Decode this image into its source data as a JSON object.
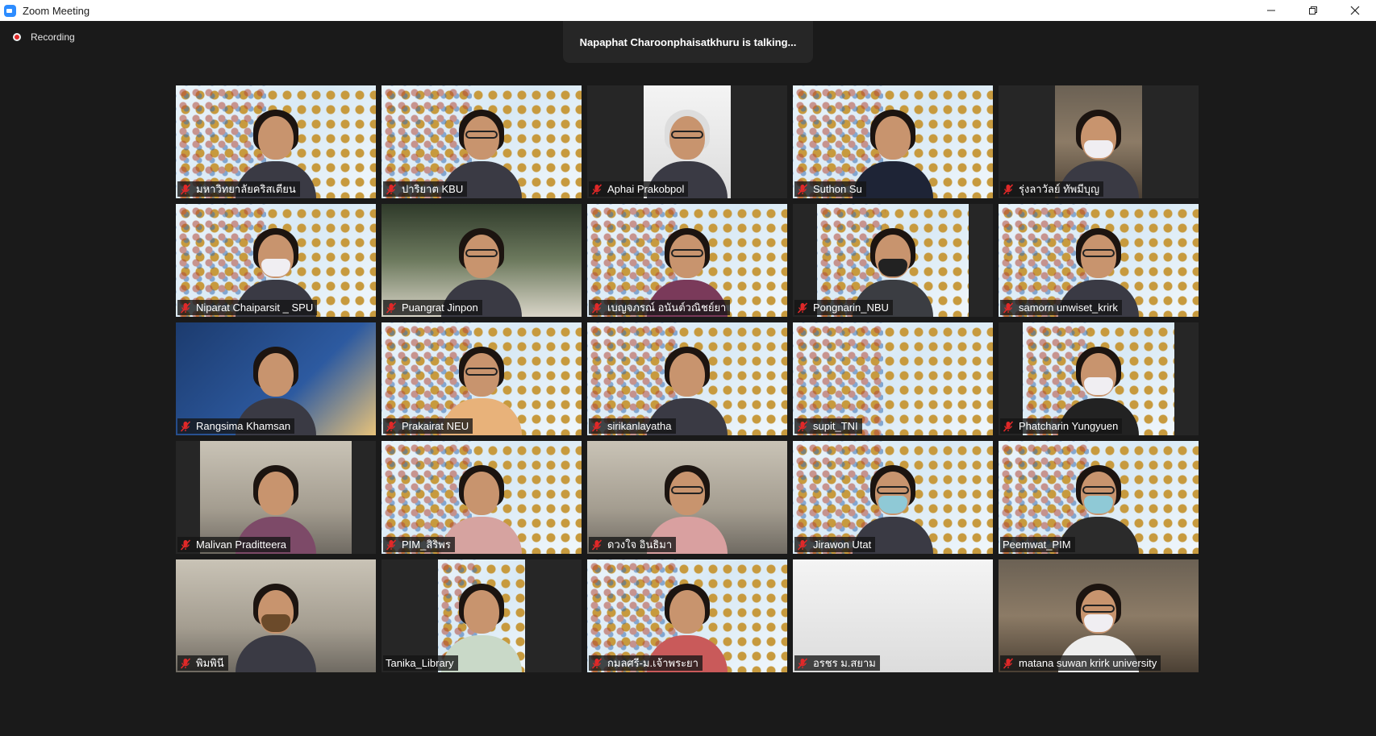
{
  "window": {
    "title": "Zoom Meeting"
  },
  "recording": {
    "label": "Recording"
  },
  "talking": {
    "text": "Napaphat Charoonphaisatkhuru is talking..."
  },
  "colors": {
    "mic_off": "#e02828",
    "stage_bg": "#1a1a1a",
    "banner_bg": "#262626"
  },
  "participants": [
    {
      "name": "มหาวิทยาลัยคริสเตียน",
      "muted": true
    },
    {
      "name": "ปาริยาต KBU",
      "muted": true
    },
    {
      "name": "Aphai Prakobpol",
      "muted": true
    },
    {
      "name": "Suthon Su",
      "muted": true
    },
    {
      "name": "รุ่งลาวัลย์ ทัพมีบุญ",
      "muted": true
    },
    {
      "name": "Niparat Chaiparsit _ SPU",
      "muted": true
    },
    {
      "name": "Puangrat Jinpon",
      "muted": true
    },
    {
      "name": "เบญจภรณ์ อนันต์วณิชย์ยา",
      "muted": true
    },
    {
      "name": "Pongnarin_NBU",
      "muted": true
    },
    {
      "name": "samorn unwiset_krirk",
      "muted": true
    },
    {
      "name": "Rangsima Khamsan",
      "muted": true
    },
    {
      "name": "Prakairat NEU",
      "muted": true
    },
    {
      "name": "sirikanlayatha",
      "muted": true
    },
    {
      "name": "supit_TNI",
      "muted": true
    },
    {
      "name": "Phatcharin Yungyuen",
      "muted": true
    },
    {
      "name": "Malivan Praditteera",
      "muted": true
    },
    {
      "name": "PIM_สิริพร",
      "muted": true
    },
    {
      "name": "ดวงใจ อินธิมา",
      "muted": true
    },
    {
      "name": "Jirawon Utat",
      "muted": true
    },
    {
      "name": "Peemwat_PIM",
      "muted": false
    },
    {
      "name": "พิมพินี",
      "muted": true
    },
    {
      "name": "Tanika_Library",
      "muted": false
    },
    {
      "name": "กมลศรี-ม.เจ้าพระยา",
      "muted": true
    },
    {
      "name": "อรชร ม.สยาม",
      "muted": true
    },
    {
      "name": "matana suwan krirk university",
      "muted": true
    }
  ]
}
